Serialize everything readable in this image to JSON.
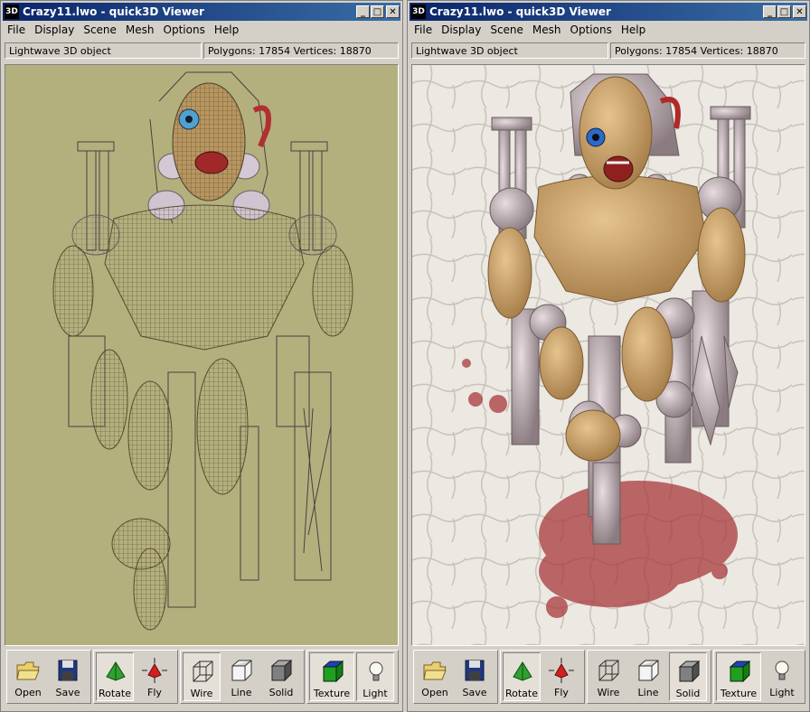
{
  "windows": [
    {
      "title": "Crazy11.lwo - quick3D Viewer",
      "app_icon_text": "3D",
      "menu": [
        "File",
        "Display",
        "Scene",
        "Mesh",
        "Options",
        "Help"
      ],
      "status_type": "Lightwave 3D object",
      "status_counts": "Polygons: 17854  Vertices: 18870",
      "view_mode": "Wire",
      "background": "#b4b07e"
    },
    {
      "title": "Crazy11.lwo - quick3D Viewer",
      "app_icon_text": "3D",
      "menu": [
        "File",
        "Display",
        "Scene",
        "Mesh",
        "Options",
        "Help"
      ],
      "status_type": "Lightwave 3D object",
      "status_counts": "Polygons: 17854  Vertices: 18870",
      "view_mode": "Solid",
      "background": "#e8e4de"
    }
  ],
  "toolbar": {
    "open": "Open",
    "save": "Save",
    "rotate": "Rotate",
    "fly": "Fly",
    "wire": "Wire",
    "line": "Line",
    "solid": "Solid",
    "texture": "Texture",
    "light": "Light"
  },
  "colors": {
    "title_start": "#0a246a",
    "title_end": "#3a6ea5",
    "skin": "#c8a070",
    "metal": "#b0a0a4",
    "blood": "#a02020"
  }
}
